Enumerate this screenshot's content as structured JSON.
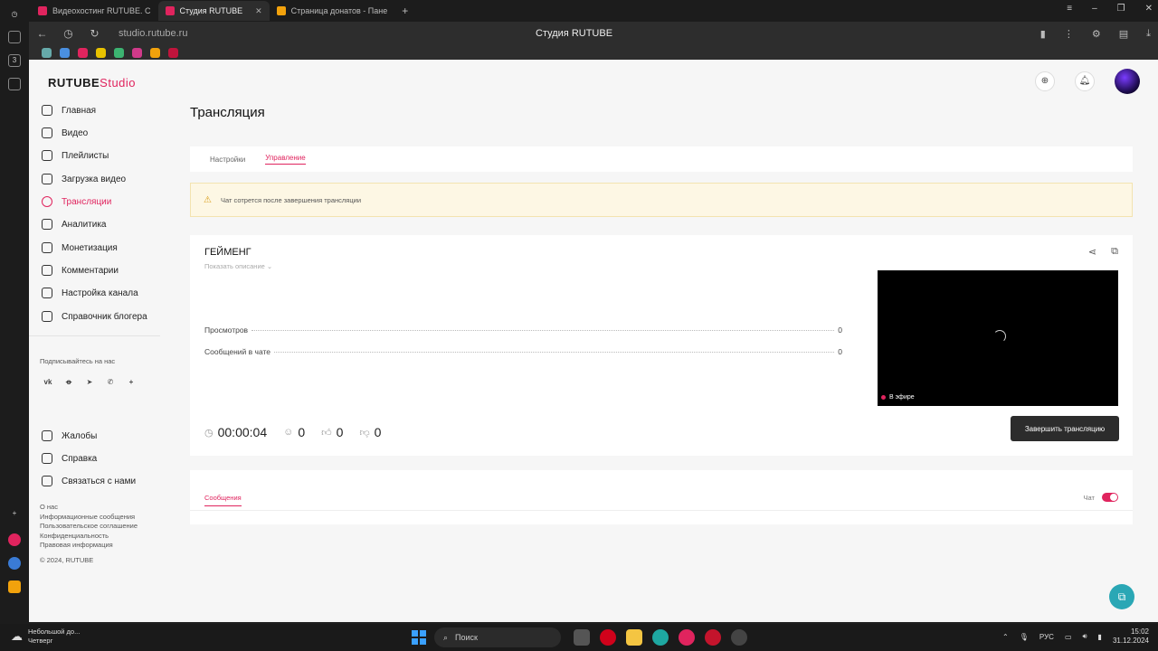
{
  "browser": {
    "tabs": [
      {
        "label": "Видеохостинг RUTUBE. С",
        "active": false,
        "color": "#e0245e"
      },
      {
        "label": "Студия RUTUBE",
        "active": true,
        "color": "#e0245e"
      },
      {
        "label": "Страница донатов - Пане",
        "active": false,
        "color": "#f2a20c"
      }
    ],
    "url": "studio.rutube.ru",
    "page_title": "Студия RUTUBE"
  },
  "app": {
    "logo": "RUTUBE",
    "logo_suffix": "Studio"
  },
  "sidebar": {
    "items": [
      {
        "label": "Главная",
        "icon": "home-icon"
      },
      {
        "label": "Видео",
        "icon": "video-icon"
      },
      {
        "label": "Плейлисты",
        "icon": "playlist-icon"
      },
      {
        "label": "Загрузка видео",
        "icon": "upload-icon"
      },
      {
        "label": "Трансляции",
        "icon": "broadcast-icon",
        "active": true
      },
      {
        "label": "Аналитика",
        "icon": "analytics-icon"
      },
      {
        "label": "Монетизация",
        "icon": "monetization-icon"
      },
      {
        "label": "Комментарии",
        "icon": "comments-icon"
      },
      {
        "label": "Настройка канала",
        "icon": "settings-icon"
      },
      {
        "label": "Справочник блогера",
        "icon": "guide-icon"
      }
    ],
    "subscribe_label": "Подписывайтесь на нас",
    "socials": [
      "vk",
      "ok",
      "telegram",
      "viber",
      "more"
    ],
    "bottom_items": [
      {
        "label": "Жалобы",
        "icon": "flag-icon"
      },
      {
        "label": "Справка",
        "icon": "help-icon"
      },
      {
        "label": "Связаться с нами",
        "icon": "mail-icon"
      }
    ],
    "footer_links": [
      "О нас",
      "Информационные сообщения",
      "Пользовательское соглашение",
      "Конфиденциальность",
      "Правовая информация"
    ],
    "copyright": "© 2024, RUTUBE"
  },
  "main": {
    "title": "Трансляция",
    "tabs": [
      {
        "label": "Настройки",
        "active": false
      },
      {
        "label": "Управление",
        "active": true
      }
    ],
    "alert": "Чат сотрется после завершения трансляции",
    "stream": {
      "title": "ГЕЙМЕНГ",
      "show_description": "Показать описание",
      "stats": [
        {
          "label": "Просмотров",
          "value": "0"
        },
        {
          "label": "Сообщений в чате",
          "value": "0"
        }
      ],
      "live_label": "В эфире",
      "duration": "00:00:04",
      "viewers": "0",
      "likes": "0",
      "dislikes": "0",
      "end_button": "Завершить трансляцию"
    },
    "chat": {
      "tab": "Сообщения",
      "toggle_label": "Чат",
      "enabled": true
    }
  },
  "taskbar": {
    "weather_line1": "Небольшой до...",
    "weather_line2": "Четверг",
    "search_placeholder": "Поиск",
    "lang": "РУС",
    "time": "15:02",
    "date": "31.12.2024"
  },
  "colors": {
    "accent": "#e0245e",
    "support": "#2aa7b5"
  }
}
